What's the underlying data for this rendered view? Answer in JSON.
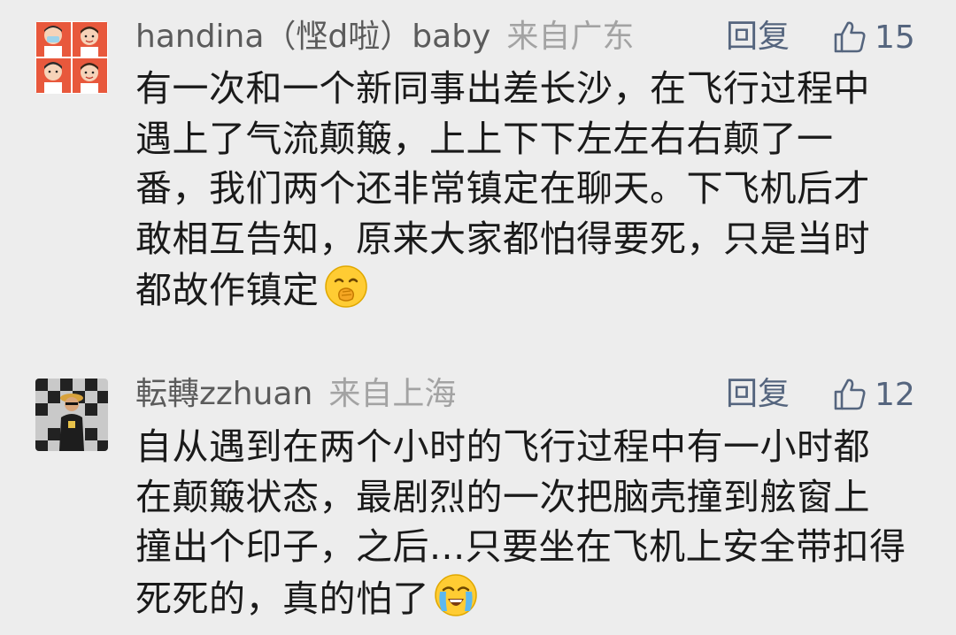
{
  "comments": [
    {
      "username": "handina（悭d啦）baby",
      "location": "来自广东",
      "reply_label": "回复",
      "like_count": "15",
      "lines": [
        "有一次和一个新同事出差长沙，在飞行过程中",
        "遇上了气流颠簸，上上下下左左右右颠了一",
        "番，我们两个还非常镇定在聊天。下飞机后才",
        "敢相互告知，原来大家都怕得要死，只是当时",
        "都故作镇定"
      ],
      "emoji": "face-with-hand-over-mouth"
    },
    {
      "username": "転轉zzhuan",
      "location": "来自上海",
      "reply_label": "回复",
      "like_count": "12",
      "lines": [
        "自从遇到在两个小时的飞行过程中有一小时都",
        "在颠簸状态，最剧烈的一次把脑壳撞到舷窗上",
        "撞出个印子，之后...只要坐在飞机上安全带扣得",
        "死死的，真的怕了"
      ],
      "emoji": "loudly-crying-face"
    }
  ],
  "colors": {
    "background": "#ededed",
    "username": "#5b5b5b",
    "location": "#a3a3a3",
    "action": "#55657e",
    "body": "#1a1a1a"
  }
}
